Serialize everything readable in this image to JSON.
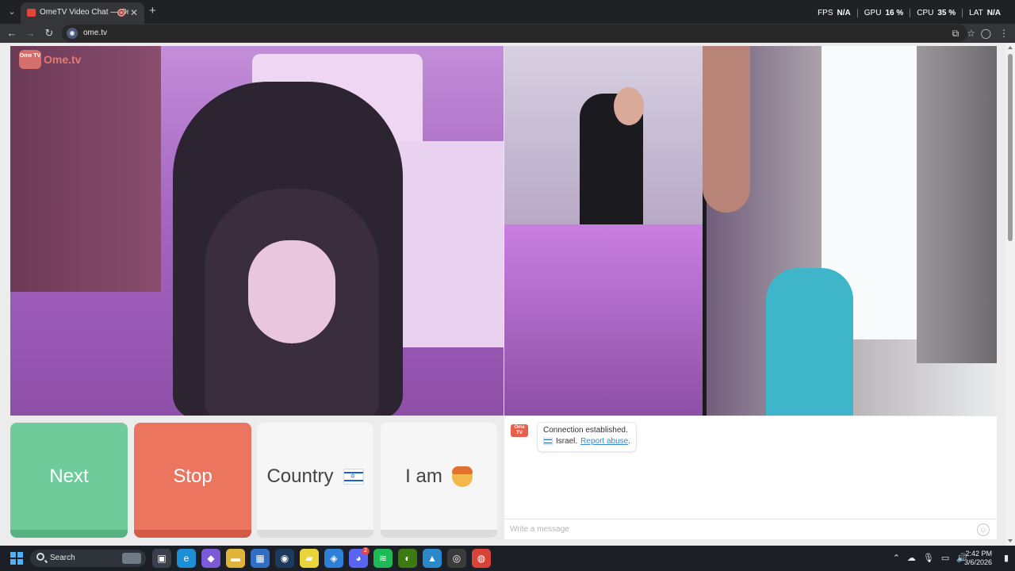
{
  "browser": {
    "tab_title": "OmeTV Video Chat — Ome",
    "tab_close_glyph": "✕",
    "new_tab_glyph": "+",
    "tab_menu_glyph": "⌄",
    "url": "ome.tv",
    "back_glyph": "←",
    "forward_glyph": "→",
    "reload_glyph": "↻",
    "stats": [
      {
        "label": "FPS",
        "value": "N/A"
      },
      {
        "label": "GPU",
        "value": "16 %"
      },
      {
        "label": "CPU",
        "value": "35 %"
      },
      {
        "label": "LAT",
        "value": "N/A"
      }
    ]
  },
  "page": {
    "logo_text": "Ome.tv",
    "logo_badge": "Ome TV",
    "buttons": {
      "next": "Next",
      "stop": "Stop",
      "country": "Country",
      "i_am": "I am"
    },
    "country_flag": "israel-flag",
    "gender_icon": "boy-emoji",
    "chat": {
      "badge": "Ome TV",
      "status": "Connection established.",
      "country": "Israel.",
      "report_link": "Report abuse",
      "trailing": ".",
      "input_placeholder": "Write a message",
      "emoji_glyph": "☺"
    }
  },
  "taskbar": {
    "search_label": "Search",
    "apps": [
      {
        "name": "task-view-icon",
        "glyph": "▣",
        "color": "#3a3f49"
      },
      {
        "name": "edge-icon",
        "glyph": "e",
        "color": "#1d8fd6"
      },
      {
        "name": "copilot-icon",
        "glyph": "◆",
        "color": "#7a5ad6"
      },
      {
        "name": "file-explorer-icon",
        "glyph": "▬",
        "color": "#e0b33a"
      },
      {
        "name": "store-icon",
        "glyph": "▦",
        "color": "#2f6ec4"
      },
      {
        "name": "steam-icon",
        "glyph": "◉",
        "color": "#1b3a5c"
      },
      {
        "name": "sticky-notes-icon",
        "glyph": "▰",
        "color": "#e8d53c"
      },
      {
        "name": "bitwarden-icon",
        "glyph": "◈",
        "color": "#2d7fd8"
      },
      {
        "name": "discord-icon",
        "glyph": "◕",
        "color": "#5865f2",
        "badge": "2"
      },
      {
        "name": "spotify-icon",
        "glyph": "≋",
        "color": "#1db954"
      },
      {
        "name": "nvidia-icon",
        "glyph": "◐",
        "color": "#3d7a12"
      },
      {
        "name": "photos-icon",
        "glyph": "▲",
        "color": "#2a88c9"
      },
      {
        "name": "obs-icon",
        "glyph": "◎",
        "color": "#3a3a3a"
      },
      {
        "name": "chrome-icon",
        "glyph": "◍",
        "color": "#d9443a"
      }
    ],
    "tray_glyphs": [
      "⌃",
      "☁",
      "🎙",
      "▭",
      "🔊"
    ],
    "time": "2:42 PM",
    "date": "3/6/2026",
    "notif_glyph": "▮"
  }
}
